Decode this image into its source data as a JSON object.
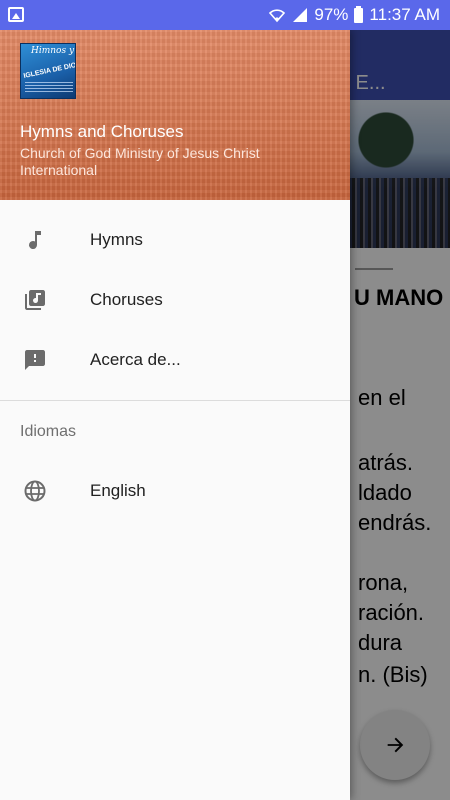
{
  "status_bar": {
    "battery": "97%",
    "time": "11:37 AM"
  },
  "background": {
    "toolbar_title": "MANO E...",
    "heading": "U MANO",
    "lines": [
      "en el",
      "atrás.",
      "ldado",
      "endrás.",
      "rona,",
      "ración.",
      "dura",
      "n. (Bis)"
    ]
  },
  "drawer": {
    "header": {
      "title": "Hymns and Choruses",
      "subtitle": "Church of God Ministry of Jesus Christ International",
      "logo": {
        "line1": "Himnos y Coros",
        "line2": "IGLESIA DE DIOS"
      }
    },
    "menu": [
      {
        "label": "Hymns",
        "icon": "music-note-icon"
      },
      {
        "label": "Choruses",
        "icon": "library-music-icon"
      },
      {
        "label": "Acerca de...",
        "icon": "feedback-icon"
      }
    ],
    "languages_section": {
      "title": "Idiomas",
      "items": [
        {
          "label": "English",
          "icon": "globe-icon"
        }
      ]
    }
  },
  "colors": {
    "status_bar": "#5a68ea",
    "toolbar": "#3f51b5",
    "header_orange": "#d57750"
  }
}
